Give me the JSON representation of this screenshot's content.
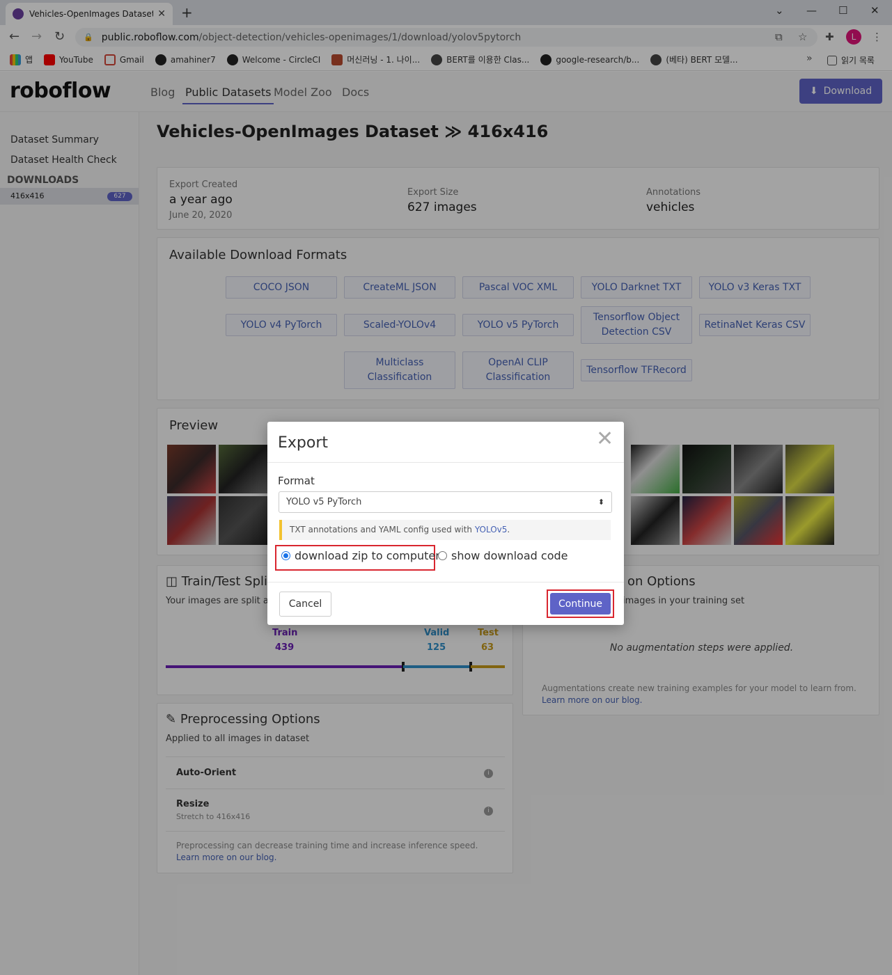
{
  "browser": {
    "tab_title": "Vehicles-OpenImages Dataset -",
    "url_host": "public.roboflow.com",
    "url_path": "/object-detection/vehicles-openimages/1/download/yolov5pytorch",
    "profile_initial": "L",
    "bookmarks": [
      "앱",
      "YouTube",
      "Gmail",
      "amahiner7",
      "Welcome - CircleCI",
      "머신러닝 - 1. 나이...",
      "BERT를 이용한 Clas...",
      "google-research/b...",
      "(베타) BERT 모델...",
      "읽기 목록"
    ],
    "more_bookmarks": "»"
  },
  "header": {
    "logo": "roboflow",
    "nav": [
      "Blog",
      "Public Datasets",
      "Model Zoo",
      "Docs"
    ],
    "download_label": "Download"
  },
  "sidebar": {
    "items": [
      "Dataset Summary",
      "Dataset Health Check"
    ],
    "downloads_heading": "DOWNLOADS",
    "version_label": "416x416",
    "version_count": "627"
  },
  "main": {
    "title": "Vehicles-OpenImages Dataset",
    "title_version": "416x416",
    "export_created_label": "Export Created",
    "export_created_value": "a year ago",
    "export_created_date": "June 20, 2020",
    "export_size_label": "Export Size",
    "export_size_value": "627 images",
    "annotations_label": "Annotations",
    "annotations_value": "vehicles",
    "formats_title": "Available Download Formats",
    "formats": [
      "COCO JSON",
      "CreateML JSON",
      "Pascal VOC XML",
      "YOLO Darknet TXT",
      "YOLO v3 Keras TXT",
      "YOLO v4 PyTorch",
      "Scaled-YOLOv4",
      "YOLO v5 PyTorch",
      "Tensorflow Object Detection CSV",
      "RetinaNet Keras CSV",
      "Multiclass Classification",
      "OpenAI CLIP Classification",
      "Tensorflow TFRecord"
    ],
    "preview_title": "Preview",
    "split_title": "Train/Test Split",
    "split_sub": "Your images are split a",
    "train_label": "Train",
    "train_value": "439",
    "valid_label": "Valid",
    "valid_value": "125",
    "test_label": "Test",
    "test_value": "63",
    "split_fractions": {
      "train": 0.7,
      "valid": 0.2,
      "test": 0.1
    },
    "aug_title": "on Options",
    "aug_sub": "images in your training set",
    "aug_none": "No augmentation steps were applied.",
    "aug_note": "Augmentations create new training examples for your model to learn from.",
    "aug_link": "Learn more on our blog.",
    "pre_title": "Preprocessing Options",
    "pre_sub": "Applied to all images in dataset",
    "pre_auto_orient": "Auto-Orient",
    "pre_resize": "Resize",
    "pre_resize_sub": "Stretch to 416x416",
    "pre_note": "Preprocessing can decrease training time and increase inference speed.",
    "pre_link": "Learn more on our blog."
  },
  "modal": {
    "title": "Export",
    "format_label": "Format",
    "format_selected": "YOLO v5 PyTorch",
    "note_text": "TXT annotations and YAML config used with",
    "note_link": "YOLOv5",
    "radio_zip": "download zip to computer",
    "radio_code": "show download code",
    "cancel": "Cancel",
    "continue": "Continue"
  },
  "colors": {
    "accent": "#5e63c7",
    "train": "#6a1fb5",
    "valid": "#2f8fc9",
    "test": "#c79a1a",
    "highlight": "#d9262f"
  }
}
